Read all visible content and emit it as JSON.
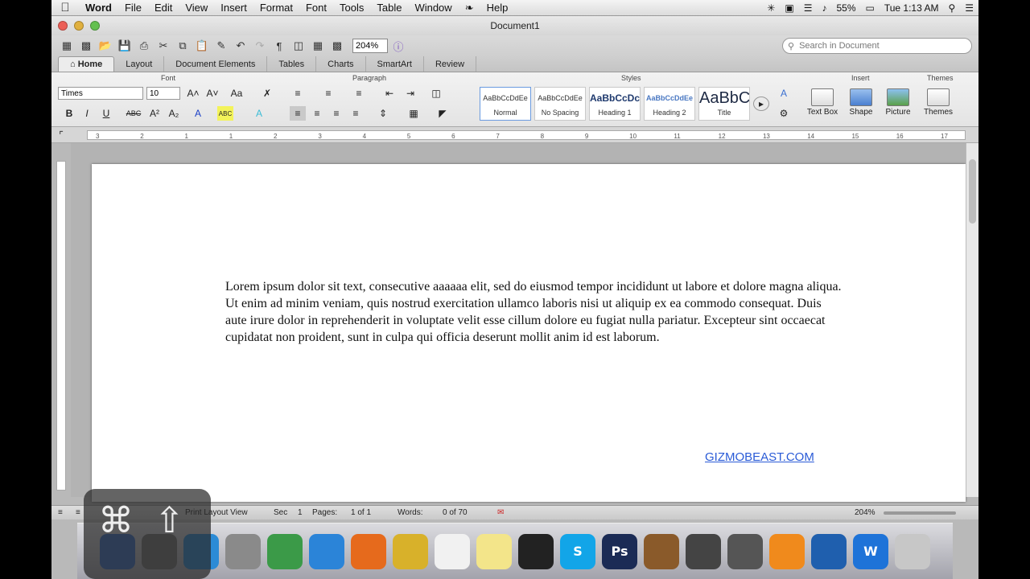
{
  "menubar": {
    "app": "Word",
    "items": [
      "File",
      "Edit",
      "View",
      "Insert",
      "Format",
      "Font",
      "Tools",
      "Table",
      "Window",
      "Help"
    ],
    "battery": "55%",
    "clock": "Tue 1:13 AM"
  },
  "window": {
    "title": "Document1"
  },
  "toolbar": {
    "zoom": "204%",
    "search_placeholder": "Search in Document"
  },
  "ribbon": {
    "tabs": [
      "Home",
      "Layout",
      "Document Elements",
      "Tables",
      "Charts",
      "SmartArt",
      "Review"
    ],
    "groups": {
      "font": "Font",
      "paragraph": "Paragraph",
      "styles": "Styles",
      "insert": "Insert",
      "themes": "Themes"
    },
    "font_name": "Times",
    "font_size": "10",
    "styles": [
      {
        "preview": "AaBbCcDdEe",
        "name": "Normal"
      },
      {
        "preview": "AaBbCcDdEe",
        "name": "No Spacing"
      },
      {
        "preview": "AaBbCcDc",
        "name": "Heading 1"
      },
      {
        "preview": "AaBbCcDdEe",
        "name": "Heading 2"
      },
      {
        "preview": "AaBbC",
        "name": "Title"
      }
    ],
    "insert": [
      "Text Box",
      "Shape",
      "Picture"
    ],
    "themes": "Themes"
  },
  "ruler_numbers": [
    "3",
    "2",
    "1",
    "1",
    "2",
    "3",
    "4",
    "5",
    "6",
    "7",
    "8",
    "9",
    "10",
    "11",
    "12",
    "13",
    "14",
    "15",
    "16",
    "17"
  ],
  "document": {
    "text": "Lorem ipsum dolor sit text, consecutive aaaaaa elit, sed do eiusmod tempor incididunt ut labore et dolore magna aliqua. Ut enim ad minim veniam, quis nostrud exercitation ullamco laboris nisi ut aliquip ex ea commodo consequat. Duis aute irure dolor in reprehenderit in voluptate velit esse cillum dolore eu fugiat nulla pariatur. Excepteur sint occaecat cupidatat non proident, sunt in culpa qui officia deserunt mollit anim id est laborum."
  },
  "watermark": "GIZMOBEAST.COM",
  "status": {
    "view": "Print Layout View",
    "sec_label": "Sec",
    "sec": "1",
    "pages_label": "Pages:",
    "pages": "1 of 1",
    "words_label": "Words:",
    "words": "0 of 70",
    "zoom": "204%"
  },
  "dock": {
    "apps": [
      {
        "name": "finder",
        "label": "",
        "color": "#3b6fc9"
      },
      {
        "name": "system-preferences",
        "label": "",
        "color": "#777"
      },
      {
        "name": "itunes",
        "label": "",
        "color": "#2b8bd6"
      },
      {
        "name": "launchpad",
        "label": "",
        "color": "#8a8a8a"
      },
      {
        "name": "preview",
        "label": "",
        "color": "#3b9a48"
      },
      {
        "name": "safari",
        "label": "",
        "color": "#2b84d8"
      },
      {
        "name": "firefox",
        "label": "",
        "color": "#e66a1c"
      },
      {
        "name": "word-alt",
        "label": "",
        "color": "#d8b12a"
      },
      {
        "name": "textedit",
        "label": "",
        "color": "#f1f1f1"
      },
      {
        "name": "stickies",
        "label": "",
        "color": "#f3e58a"
      },
      {
        "name": "terminal",
        "label": "",
        "color": "#222"
      },
      {
        "name": "skype",
        "label": "S",
        "color": "#12a5e8"
      },
      {
        "name": "photoshop",
        "label": "Ps",
        "color": "#1b2b55"
      },
      {
        "name": "garageband",
        "label": "",
        "color": "#8a5a2a"
      },
      {
        "name": "imovie",
        "label": "",
        "color": "#444"
      },
      {
        "name": "final-cut",
        "label": "",
        "color": "#555"
      },
      {
        "name": "vlc",
        "label": "",
        "color": "#f08a1c"
      },
      {
        "name": "quicktime",
        "label": "",
        "color": "#1f5fae"
      },
      {
        "name": "word",
        "label": "W",
        "color": "#1e73d8"
      },
      {
        "name": "trash",
        "label": "",
        "color": "#c7c7c7"
      }
    ]
  },
  "overlay": {
    "cmd": "⌘",
    "shift": "⇧"
  }
}
